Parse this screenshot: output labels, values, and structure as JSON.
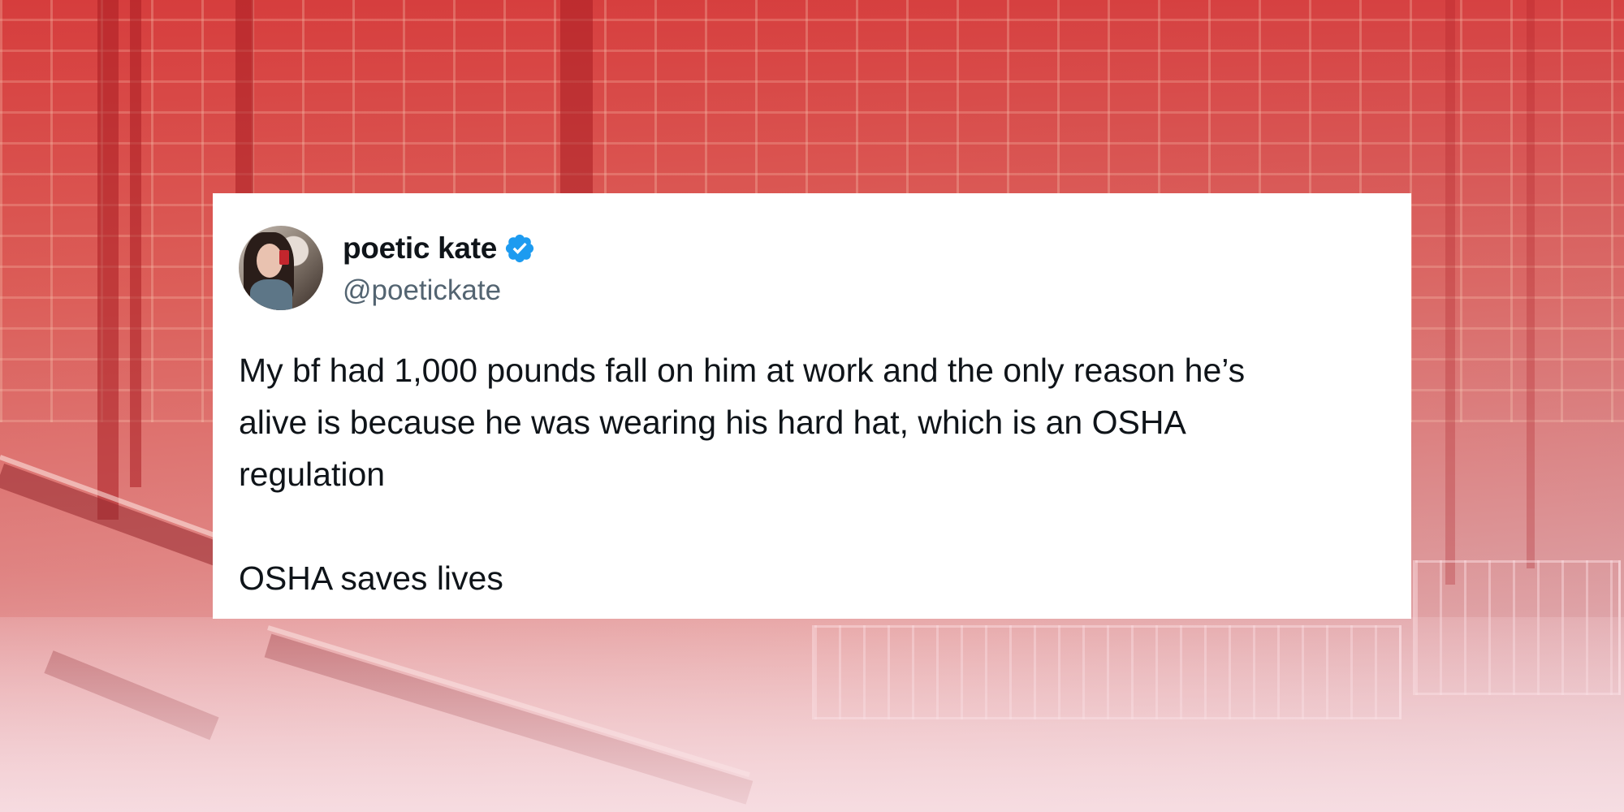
{
  "tweet": {
    "author_name": "poetic kate",
    "handle": "@poetickate",
    "verified_icon": "verified-badge-icon",
    "verified_color": "#1d9bf0",
    "paragraphs": [
      "My bf had 1,000 pounds fall on him at work and the only reason he’s\nalive is because he was wearing his hard hat, which is an OSHA\nregulation",
      "OSHA saves lives"
    ]
  },
  "colors": {
    "background_tint": "#d74a45",
    "card": "#ffffff",
    "text": "#0f1419",
    "secondary_text": "#536471"
  }
}
